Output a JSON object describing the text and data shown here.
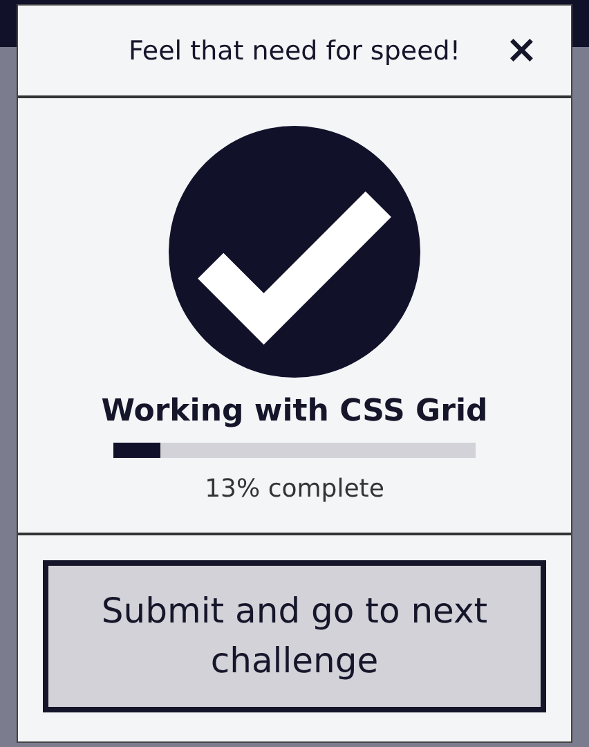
{
  "modal": {
    "title": "Feel that need for speed!",
    "close": "×"
  },
  "progress": {
    "completed": true,
    "title": "Working with CSS Grid",
    "level": 0.13,
    "reading": "13% complete"
  },
  "button": {
    "label": "Submit and go to next challenge"
  }
}
